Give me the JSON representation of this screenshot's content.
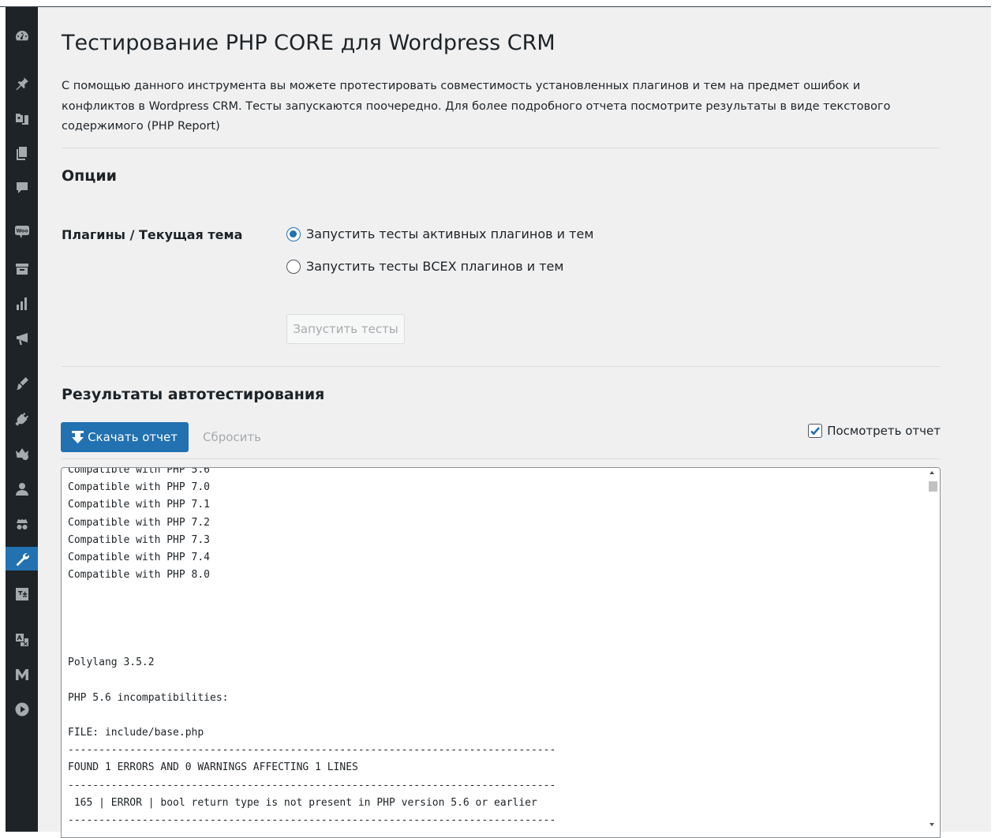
{
  "sidebar": {
    "icons": [
      {
        "name": "dashboard-icon"
      },
      {
        "name": "pin-icon"
      },
      {
        "name": "media-icon"
      },
      {
        "name": "pages-icon"
      },
      {
        "name": "comments-icon"
      },
      {
        "name": "woocommerce-icon",
        "text": "Woo"
      },
      {
        "name": "products-icon"
      },
      {
        "name": "analytics-icon"
      },
      {
        "name": "marketing-icon"
      },
      {
        "name": "appearance-icon"
      },
      {
        "name": "plugins-icon"
      },
      {
        "name": "users-icon"
      },
      {
        "name": "incognito-icon"
      },
      {
        "name": "tools-icon",
        "active": true
      },
      {
        "name": "settings-icon"
      },
      {
        "name": "translate-icon"
      },
      {
        "name": "m-logo-icon"
      },
      {
        "name": "play-icon"
      }
    ]
  },
  "page": {
    "title": "Тестирование PHP CORE для Wordpress CRM",
    "intro": "С помощью данного инструмента вы можете протестировать совместимость установленных плагинов и тем на предмет ошибок и конфликтов в Wordpress CRM. Тесты запускаются поочередно. Для более подробного отчета посмотрите результаты в виде текстового содержимого (PHP Report)"
  },
  "options": {
    "title": "Опции",
    "field_label": "Плагины / Текущая тема",
    "radio_active": "Запустить тесты активных плагинов и тем",
    "radio_all": "Запустить тесты ВСЕХ плагинов и тем",
    "selected": "active",
    "run_button": "Запустить тесты"
  },
  "results": {
    "title": "Результаты автотестирования",
    "download_button": "Скачать отчет",
    "reset_link": "Сбросить",
    "view_report_label": "Посмотреть отчет",
    "view_report_checked": true,
    "report_text": "Compatible with PHP 5.6\nCompatible with PHP 7.0\nCompatible with PHP 7.1\nCompatible with PHP 7.2\nCompatible with PHP 7.3\nCompatible with PHP 7.4\nCompatible with PHP 8.0\n\n\n\n\nPolylang 3.5.2\n\nPHP 5.6 incompatibilities:\n\nFILE: include/base.php\n-------------------------------------------------------------------------------\nFOUND 1 ERRORS AND 0 WARNINGS AFFECTING 1 LINES\n-------------------------------------------------------------------------------\n 165 | ERROR | bool return type is not present in PHP version 5.6 or earlier\n-------------------------------------------------------------------------------\n\nFILE: include/crud-posts.php"
  },
  "colors": {
    "accent": "#2271b1",
    "sidebar_bg": "#1d2327",
    "content_bg": "#f0f0f1"
  }
}
